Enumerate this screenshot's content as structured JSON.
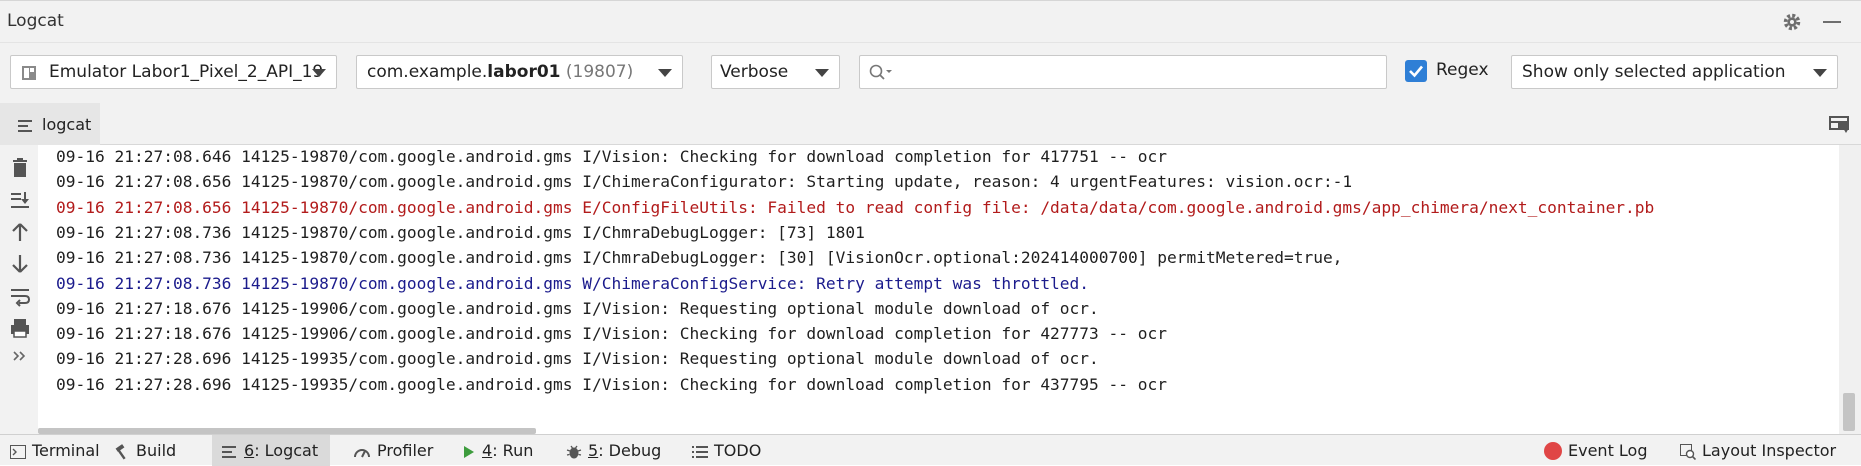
{
  "window": {
    "title": "Logcat"
  },
  "toolbar": {
    "device": "Emulator Labor1_Pixel_2_API_19",
    "package_prefix": "com.example.",
    "package_bold": "labor01",
    "package_pid": " (19807)",
    "log_level": "Verbose",
    "search": {
      "value": "",
      "placeholder": ""
    },
    "regex_label": "Regex",
    "regex_checked": true,
    "filter": "Show only selected application"
  },
  "tab": {
    "label": "logcat"
  },
  "log_lines": [
    {
      "level": "I",
      "text": "09-16 21:27:08.646 14125-19870/com.google.android.gms I/Vision: Checking for download completion for 417751 -- ocr"
    },
    {
      "level": "I",
      "text": "09-16 21:27:08.656 14125-19870/com.google.android.gms I/ChimeraConfigurator: Starting update, reason: 4 urgentFeatures: vision.ocr:-1"
    },
    {
      "level": "E",
      "text": "09-16 21:27:08.656 14125-19870/com.google.android.gms E/ConfigFileUtils: Failed to read config file: /data/data/com.google.android.gms/app_chimera/next_container.pb"
    },
    {
      "level": "I",
      "text": "09-16 21:27:08.736 14125-19870/com.google.android.gms I/ChmraDebugLogger: [73] 1801"
    },
    {
      "level": "I",
      "text": "09-16 21:27:08.736 14125-19870/com.google.android.gms I/ChmraDebugLogger: [30] [VisionOcr.optional:202414000700] permitMetered=true,"
    },
    {
      "level": "W",
      "text": "09-16 21:27:08.736 14125-19870/com.google.android.gms W/ChimeraConfigService: Retry attempt was throttled."
    },
    {
      "level": "I",
      "text": "09-16 21:27:18.676 14125-19906/com.google.android.gms I/Vision: Requesting optional module download of ocr."
    },
    {
      "level": "I",
      "text": "09-16 21:27:18.676 14125-19906/com.google.android.gms I/Vision: Checking for download completion for 427773 -- ocr"
    },
    {
      "level": "I",
      "text": "09-16 21:27:28.696 14125-19935/com.google.android.gms I/Vision: Requesting optional module download of ocr."
    },
    {
      "level": "I",
      "text": "09-16 21:27:28.696 14125-19935/com.google.android.gms I/Vision: Checking for download completion for 437795 -- ocr"
    }
  ],
  "status_bar": {
    "terminal": "Terminal",
    "build": "Build",
    "logcat_num": "6",
    "logcat_rest": ": Logcat",
    "profiler": "Profiler",
    "run_num": "4",
    "run_rest": ": Run",
    "debug_num": "5",
    "debug_rest": ": Debug",
    "todo": "TODO",
    "event_log": "Event Log",
    "layout_inspector": "Layout Inspector"
  },
  "colors": {
    "error": "#b21b1b",
    "warning": "#1b1b8c",
    "info": "#1f1f1f",
    "accent": "#2f7fd6"
  }
}
